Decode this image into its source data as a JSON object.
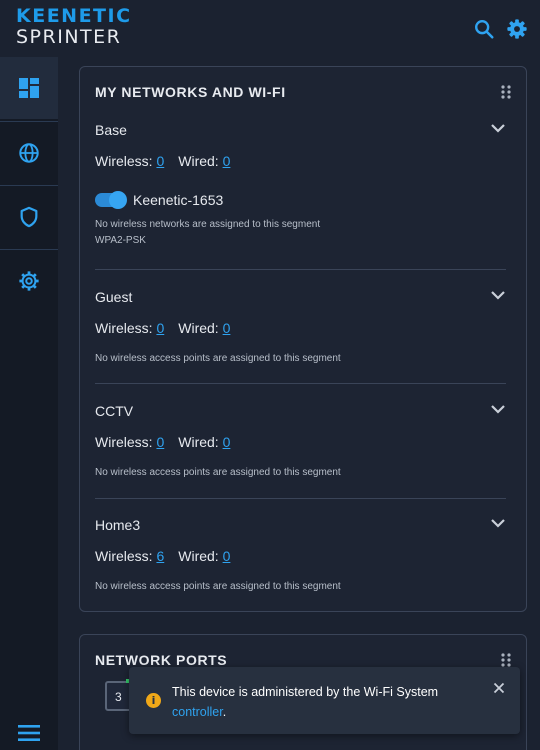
{
  "brand": {
    "line1": "KEENETIC",
    "line2": "SPRINTER"
  },
  "colors": {
    "accent": "#2fa3f0",
    "background": "#1b2230",
    "sidebar": "#141a25",
    "card_border": "#3a4458",
    "warning": "#f0a818"
  },
  "header_icons": [
    "search-icon",
    "gear-icon"
  ],
  "sidebar": {
    "items": [
      {
        "icon": "dashboard-icon",
        "active": true
      },
      {
        "icon": "globe-icon",
        "active": false
      },
      {
        "icon": "shield-icon",
        "active": false
      },
      {
        "icon": "settings-icon",
        "active": false
      }
    ],
    "menu_icon": "hamburger-icon"
  },
  "networks_card": {
    "title": "MY NETWORKS AND WI-FI",
    "wireless_label": "Wireless:",
    "wired_label": "Wired:",
    "segments": [
      {
        "name": "Base",
        "wireless": "0",
        "wired": "0",
        "wifi_name": "Keenetic-1653",
        "wifi_enabled": true,
        "note": "No wireless networks are assigned to this segment",
        "security": "WPA2-PSK"
      },
      {
        "name": "Guest",
        "wireless": "0",
        "wired": "0",
        "note": "No wireless access points are assigned to this segment"
      },
      {
        "name": "CCTV",
        "wireless": "0",
        "wired": "0",
        "note": "No wireless access points are assigned to this segment"
      },
      {
        "name": "Home3",
        "wireless": "6",
        "wired": "0",
        "note": "No wireless access points are assigned to this segment"
      }
    ]
  },
  "ports_card": {
    "title": "NETWORK PORTS",
    "port_number": "3"
  },
  "toast": {
    "message": "This device is administered by the Wi-Fi System",
    "link": "controller",
    "suffix": "."
  }
}
